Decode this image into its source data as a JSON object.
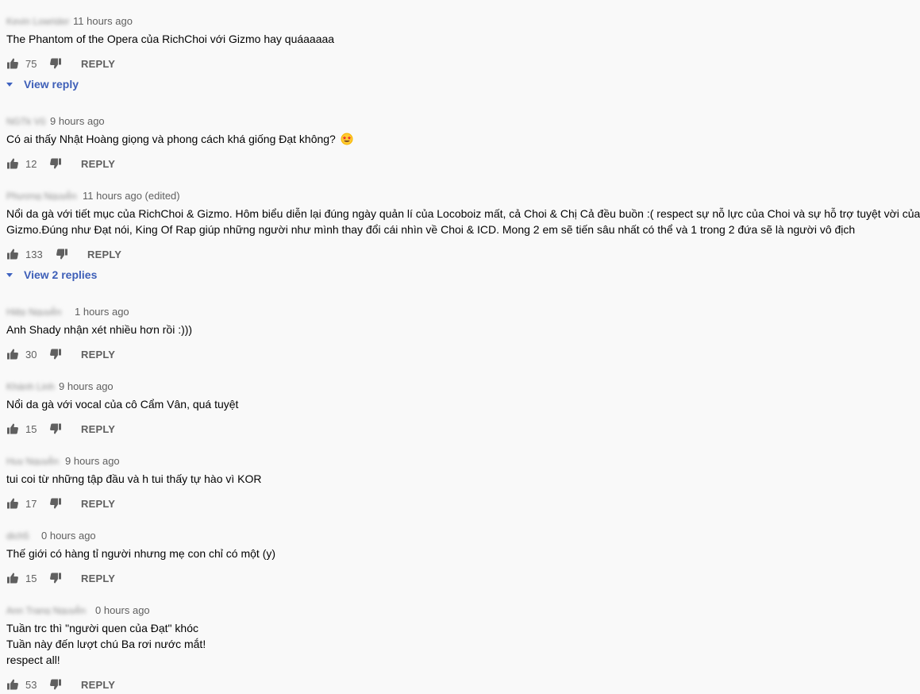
{
  "comments": [
    {
      "author": "Kevin Lowrider",
      "time": "11 hours ago",
      "lines": [
        "The Phantom of the Opera của RichChoi với Gizmo hay quáaaaaa"
      ],
      "likes": "75",
      "reply_label": "REPLY",
      "view_replies": "View reply"
    },
    {
      "author": "NGTk Vũ",
      "time": "9 hours ago",
      "lines": [
        "Có ai thấy Nhật Hoàng giọng và phong cách khá giống Đạt không?"
      ],
      "emoji": "star-struck-emoji",
      "likes": "12",
      "reply_label": "REPLY"
    },
    {
      "author": "Phương Nguyễn",
      "time": "11 hours ago (edited)",
      "lines": [
        "Nổi da gà với tiết mục của RichChoi & Gizmo. Hôm biểu diễn lại đúng ngày quản lí của Locoboiz mất, cả Choi & Chị Cả đều buồn :( respect sự nỗ lực của Choi và sự hỗ trợ tuyệt vời của",
        "Gizmo.Đúng như Đạt nói, King Of Rap giúp những người như mình thay đổi cái nhìn về Choi & ICD. Mong 2 em sẽ tiến sâu nhất có thể và 1 trong 2 đứa sẽ là người vô địch"
      ],
      "likes": "133",
      "reply_label": "REPLY",
      "view_replies": "View 2 replies"
    },
    {
      "author": "Hiệp Nguyễn",
      "time": "1 hours ago",
      "lines": [
        "Anh Shady nhận xét nhiều hơn rồi :)))"
      ],
      "likes": "30",
      "reply_label": "REPLY"
    },
    {
      "author": "Khánh Linh",
      "time": "9 hours ago",
      "lines": [
        "Nổi da gà với vocal của cô Cẩm Vân, quá tuyệt"
      ],
      "likes": "15",
      "reply_label": "REPLY"
    },
    {
      "author": "Huy Nguyễn",
      "time": "9 hours ago",
      "lines": [
        "tui coi từ những tập đầu và h tui thấy tự hào vì KOR"
      ],
      "likes": "17",
      "reply_label": "REPLY"
    },
    {
      "author": "dịch5",
      "time": "0 hours ago",
      "lines": [
        "Thế giới có hàng tỉ người nhưng mẹ con chỉ có một (y)"
      ],
      "likes": "15",
      "reply_label": "REPLY"
    },
    {
      "author": "Ann Trang Nguyễn",
      "time": "0 hours ago",
      "lines": [
        "Tuần trc thì \"người quen của Đạt\" khóc",
        "Tuần này đến lượt chú Ba rơi nước mắt!",
        "respect all!"
      ],
      "likes": "53",
      "reply_label": "REPLY"
    }
  ]
}
